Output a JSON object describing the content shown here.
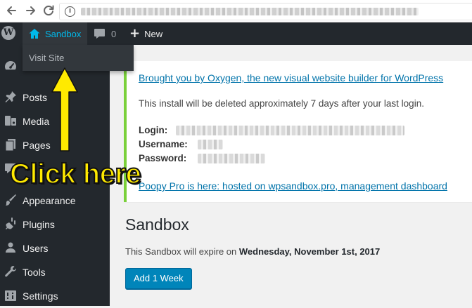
{
  "adminbar": {
    "site_name": "Sandbox",
    "comments_count": "0",
    "new_label": "New",
    "dropdown_item": "Visit Site"
  },
  "sidebar": {
    "items": [
      {
        "label": "Posts",
        "icon": "pin-icon"
      },
      {
        "label": "Media",
        "icon": "media-icon"
      },
      {
        "label": "Pages",
        "icon": "pages-icon"
      },
      {
        "label": "Appearance",
        "icon": "brush-icon"
      },
      {
        "label": "Plugins",
        "icon": "plug-icon"
      },
      {
        "label": "Users",
        "icon": "user-icon"
      },
      {
        "label": "Tools",
        "icon": "wrench-icon"
      },
      {
        "label": "Settings",
        "icon": "settings-icon"
      }
    ]
  },
  "notice": {
    "link1": "Brought you by Oxygen, the new visual website builder for WordPress",
    "info": "This install will be deleted approximately 7 days after your last login.",
    "login_label": "Login:",
    "username_label": "Username:",
    "password_label": "Password:",
    "link2": "Poopy Pro is here: hosted on wpsandbox.pro, management dashboard"
  },
  "main": {
    "title": "Sandbox",
    "expire_prefix": "This Sandbox will expire on ",
    "expire_date": "Wednesday, November 1st, 2017",
    "add_button": "Add 1 Week"
  },
  "annotation": {
    "text": "Click here",
    "color": "#ffea00"
  },
  "colors": {
    "adminbar_bg": "#23282d",
    "link": "#0073aa",
    "button": "#0085ba",
    "notice_border": "#7ad03a",
    "site_name": "#00b9eb"
  }
}
